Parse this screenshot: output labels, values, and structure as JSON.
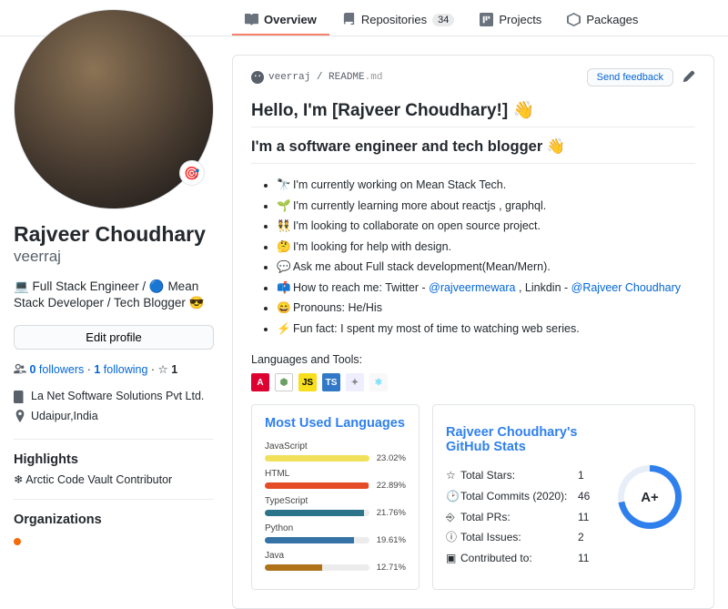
{
  "tabs": {
    "overview": "Overview",
    "repos": "Repositories",
    "repos_count": "34",
    "projects": "Projects",
    "packages": "Packages"
  },
  "profile": {
    "name": "Rajveer Choudhary",
    "login": "veerraj",
    "bio_prefix": "💻 Full Stack Engineer / ",
    "bio_icon": "🔵",
    "bio_suffix": " Mean Stack Developer / Tech Blogger 😎",
    "edit": "Edit profile",
    "followers_count": "0",
    "followers_label": " followers",
    "dot1": " · ",
    "following_count": "1",
    "following_label": " following",
    "dot2": " · ",
    "star_icon": "☆ ",
    "star_count": "1",
    "company": "La Net Software Solutions Pvt Ltd.",
    "location": "Udaipur,India",
    "highlights_h": "Highlights",
    "highlight_item": "Arctic Code Vault Contributor",
    "orgs_h": "Organizations"
  },
  "readme": {
    "path_user": "veerraj",
    "path_slash": " / ",
    "path_file": "README",
    "path_ext": ".md",
    "feedback": "Send feedback",
    "hello": "Hello, I'm [Rajveer Choudhary!] 👋",
    "sub": "I'm a software engineer and tech blogger 👋",
    "bullets": {
      "b0e": "🔭",
      "b0": "I'm currently working on Mean Stack Tech.",
      "b1e": "🌱",
      "b1": "I'm currently learning more about reactjs , graphql.",
      "b2e": "👯",
      "b2": "I'm looking to collaborate on open source project.",
      "b3e": "🤔",
      "b3": "I'm looking for help with design.",
      "b4e": "💬",
      "b4": "Ask me about Full stack development(Mean/Mern).",
      "b5e": "📫",
      "b5a": "How to reach me: Twitter - ",
      "b5b": "@rajveermewara",
      "b5c": " , Linkdin - ",
      "b5d": "@Rajveer Choudhary",
      "b6e": "😄",
      "b6": "Pronouns: He/His",
      "b7e": "⚡",
      "b7": "Fun fact: I spent my most of time to watching web series."
    },
    "tools_label": "Languages and Tools:"
  },
  "langs_card": {
    "title": "Most Used Languages"
  },
  "stats_card": {
    "title": "Rajveer Choudhary's GitHub Stats",
    "r0l": "Total Stars:",
    "r0v": "1",
    "r1l": "Total Commits (2020):",
    "r1v": "46",
    "r2l": "Total PRs:",
    "r2v": "11",
    "r3l": "Total Issues:",
    "r3v": "2",
    "r4l": "Contributed to:",
    "r4v": "11",
    "grade": "A+"
  },
  "chart_data": {
    "type": "bar",
    "title": "Most Used Languages",
    "categories": [
      "JavaScript",
      "HTML",
      "TypeScript",
      "Python",
      "Java"
    ],
    "values": [
      23.02,
      22.89,
      21.76,
      19.61,
      12.71
    ],
    "colors": [
      "#f1e05a",
      "#e34c26",
      "#2b7489",
      "#3572A5",
      "#b07219"
    ],
    "xlabel": "",
    "ylabel": "%",
    "ylim": [
      0,
      25
    ]
  }
}
